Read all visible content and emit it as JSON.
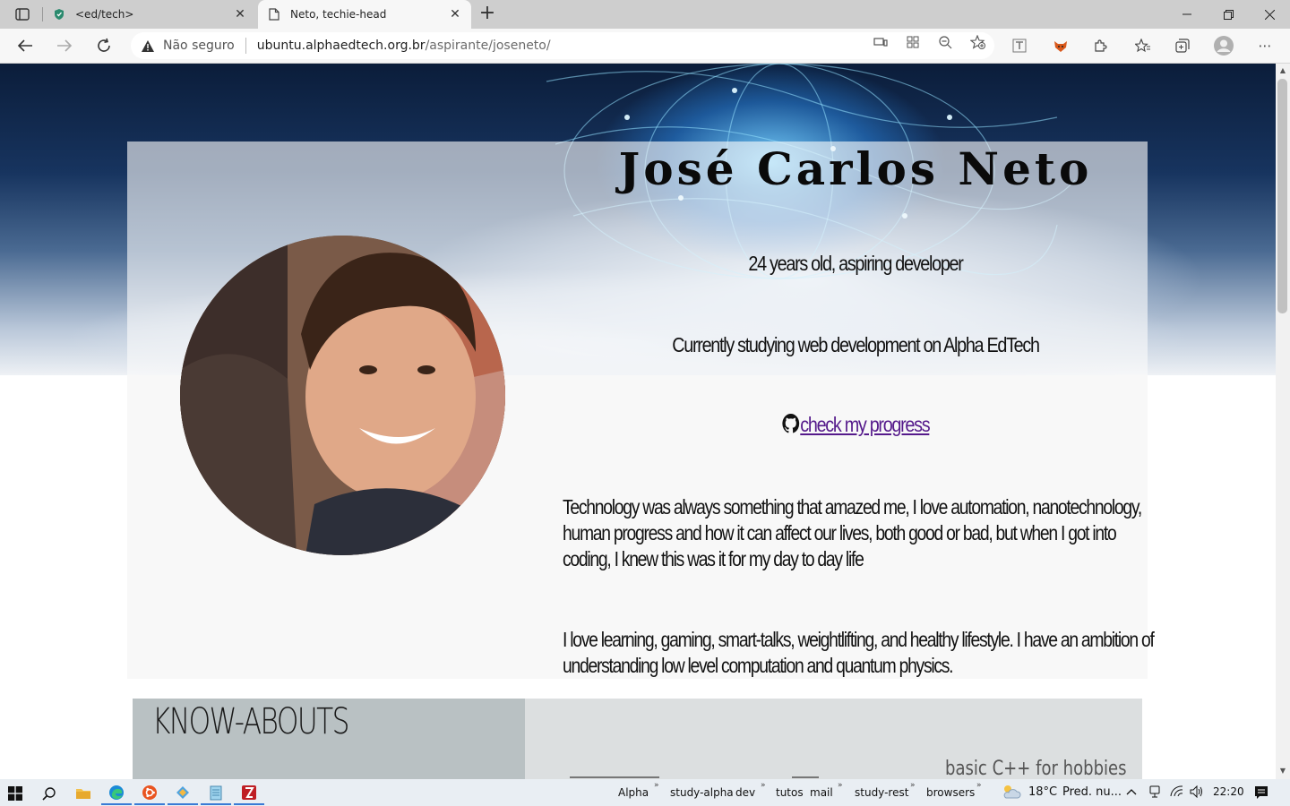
{
  "browser": {
    "tabs": [
      {
        "title": "<ed/tech>",
        "favicon": "shield-favicon"
      },
      {
        "title": "Neto, techie-head",
        "favicon": "page-favicon",
        "active": true
      }
    ],
    "new_tab_label": "+",
    "security_label": "Não seguro",
    "url_host": "ubuntu.alphaedtech.org.br",
    "url_path": "/aspirante/joseneto/"
  },
  "page": {
    "name": "José Carlos Neto",
    "tagline": "24 years old, aspiring developer",
    "studying": "Currently studying web development on Alpha EdTech",
    "progress_link": "check my progress",
    "paragraph_1": "Technology was always something that amazed me, I love automation, nanotechnology, human progress and how it can affect our lives, both good or bad, but when I got into coding, I knew this was it for my day to day life",
    "paragraph_2": "I love learning, gaming, smart-talks, weightlifting, and healthy lifestyle. I have an ambition of understanding low level computation and quantum physics.",
    "know_abouts_title": "KNOW-ABOUTS",
    "know_items": [
      "basic C++ for hobbies"
    ]
  },
  "taskbar": {
    "links": [
      "Alpha",
      "study-alpha",
      "dev",
      "tutos",
      "mail",
      "study-rest",
      "browsers"
    ],
    "weather": "18°C",
    "weather_text": "Pred. nu...",
    "time": "22:20"
  },
  "colors": {
    "accent_link": "#551a8b",
    "card_bg": "#f8f8f8",
    "know_head_bg": "#b9c1c3",
    "know_bg": "#dcdfe0"
  }
}
